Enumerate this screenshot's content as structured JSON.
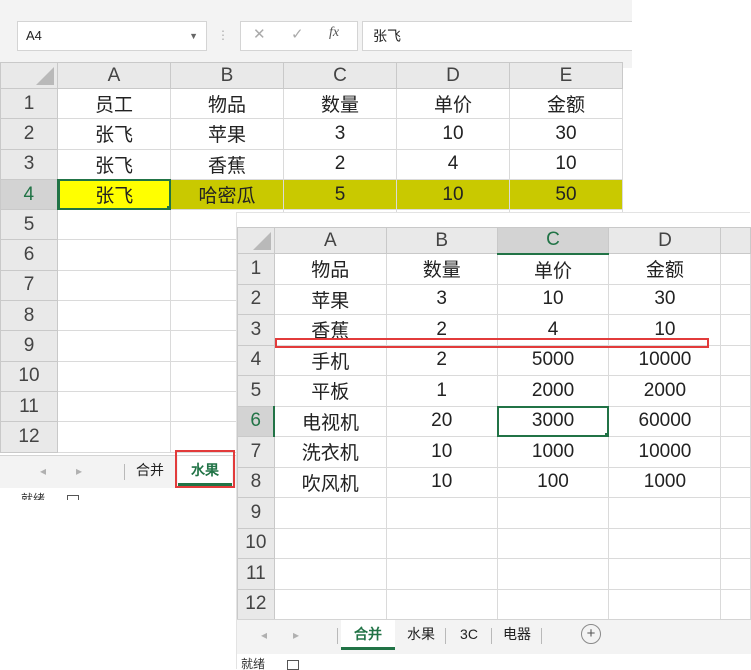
{
  "window1": {
    "name_box": "A4",
    "fx_label": "fx",
    "formula_value": "张飞",
    "columns": [
      "A",
      "B",
      "C",
      "D",
      "E"
    ],
    "rows": [
      {
        "n": "1",
        "cells": [
          "员工",
          "物品",
          "数量",
          "单价",
          "金额"
        ]
      },
      {
        "n": "2",
        "cells": [
          "张飞",
          "苹果",
          "3",
          "10",
          "30"
        ]
      },
      {
        "n": "3",
        "cells": [
          "张飞",
          "香蕉",
          "2",
          "4",
          "10"
        ]
      },
      {
        "n": "4",
        "cells": [
          "张飞",
          "哈密瓜",
          "5",
          "10",
          "50"
        ]
      },
      {
        "n": "5",
        "cells": [
          "",
          "",
          "",
          "",
          ""
        ]
      },
      {
        "n": "6",
        "cells": [
          "",
          "",
          "",
          "",
          ""
        ]
      },
      {
        "n": "7",
        "cells": [
          "",
          "",
          "",
          "",
          ""
        ]
      },
      {
        "n": "8",
        "cells": [
          "",
          "",
          "",
          "",
          ""
        ]
      },
      {
        "n": "9",
        "cells": [
          "",
          "",
          "",
          "",
          ""
        ]
      },
      {
        "n": "10",
        "cells": [
          "",
          "",
          "",
          "",
          ""
        ]
      },
      {
        "n": "11",
        "cells": [
          "",
          "",
          "",
          "",
          ""
        ]
      },
      {
        "n": "12",
        "cells": [
          "",
          "",
          "",
          "",
          ""
        ]
      }
    ],
    "tabs": [
      "合并",
      "水果"
    ],
    "active_tab": "水果",
    "status": "就绪",
    "highlight_yellow": "#ffff00",
    "highlight_olive": "#c9c900"
  },
  "window2": {
    "columns": [
      "A",
      "B",
      "C",
      "D"
    ],
    "rows": [
      {
        "n": "1",
        "cells": [
          "物品",
          "数量",
          "单价",
          "金额"
        ]
      },
      {
        "n": "2",
        "cells": [
          "苹果",
          "3",
          "10",
          "30"
        ]
      },
      {
        "n": "3",
        "cells": [
          "香蕉",
          "2",
          "4",
          "10"
        ]
      },
      {
        "n": "4",
        "cells": [
          "手机",
          "2",
          "5000",
          "10000"
        ]
      },
      {
        "n": "5",
        "cells": [
          "平板",
          "1",
          "2000",
          "2000"
        ]
      },
      {
        "n": "6",
        "cells": [
          "电视机",
          "20",
          "3000",
          "60000"
        ]
      },
      {
        "n": "7",
        "cells": [
          "洗衣机",
          "10",
          "1000",
          "10000"
        ]
      },
      {
        "n": "8",
        "cells": [
          "吹风机",
          "10",
          "100",
          "1000"
        ]
      },
      {
        "n": "9",
        "cells": [
          "",
          "",
          "",
          ""
        ]
      },
      {
        "n": "10",
        "cells": [
          "",
          "",
          "",
          ""
        ]
      },
      {
        "n": "11",
        "cells": [
          "",
          "",
          "",
          ""
        ]
      },
      {
        "n": "12",
        "cells": [
          "",
          "",
          "",
          ""
        ]
      }
    ],
    "tabs": [
      "合并",
      "水果",
      "3C",
      "电器"
    ],
    "active_tab": "合并",
    "status": "就绪",
    "accent": "#217346",
    "annotation_color": "#e23b3b"
  }
}
